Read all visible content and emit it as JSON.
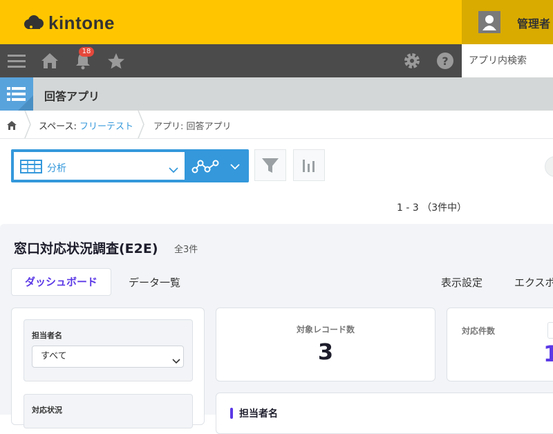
{
  "header": {
    "logo_text": "kintone",
    "username": "管理者"
  },
  "nav": {
    "notification_count": "18",
    "search_placeholder": "アプリ内検索"
  },
  "app": {
    "title": "回答アプリ"
  },
  "breadcrumb": {
    "space_prefix": "スペース: ",
    "space_name": "フリーテスト",
    "app_crumb": "アプリ: 回答アプリ"
  },
  "toolbar": {
    "view_name": "分析",
    "paging": "1 - 3 （3件中）"
  },
  "plugin": {
    "title": "窓口対応状況調査(E2E)",
    "total": "全3件",
    "tabs": [
      "ダッシュボード",
      "データ一覧"
    ],
    "actions": [
      "表示設定",
      "エクスポ"
    ],
    "filters": [
      {
        "label": "担当者名",
        "value": "すべて"
      },
      {
        "label": "対応状況"
      }
    ],
    "kpis": [
      {
        "label": "対象レコード数",
        "value": "3"
      },
      {
        "label": "対応件数",
        "value": "1"
      }
    ],
    "section_title": "担当者名"
  },
  "colors": {
    "header": "#ffc600",
    "nav": "#4b4b4b",
    "accent": "#3498db",
    "tab_active": "#5b39e6"
  }
}
